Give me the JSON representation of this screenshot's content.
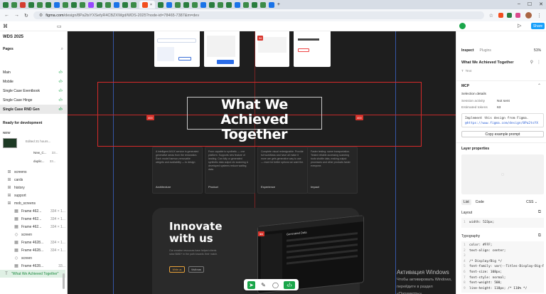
{
  "browser": {
    "url_host": "figma.com",
    "url_path": "/design/8Pa2tsYXSefyR4CBZXWgd/WDS-2025?node-id=78465-7387&m=dev",
    "tab_icon_colors": [
      "#2a7d3f",
      "#3c8b48",
      "#d43b2f",
      "#2a7d3f",
      "#3c8b48",
      "#2a7d3f",
      "#1a73e8",
      "#3c8b48",
      "#2a7d3f",
      "#3c8b48",
      "#9747ff",
      "#2a7d3f",
      "#3c8b48",
      "#1a73e8",
      "#2a7d3f",
      "#3c8b48",
      "#2a7d3f",
      "#1a73e8",
      "#3c8b48",
      "#2a7d3f",
      "#3c8b48",
      "#1a73e8",
      "#2a7d3f",
      "#3c8b48",
      "#2a7d3f",
      "#1a73e8",
      "#3c8b48",
      "#2a7d3f",
      "#3c8b48",
      "#1a73e8"
    ],
    "active_tab_close": "×",
    "new_tab": "+",
    "ext_colors": [
      "#f24e1e",
      "#2a7d3f",
      "#d94a8c"
    ]
  },
  "left": {
    "file_name": "WDS 2025",
    "pages_label": "Pages",
    "pages": [
      "Main",
      "Mobile",
      "Single Case Eventbook",
      "Single Case Hinge",
      "Single Case RND Gen"
    ],
    "ready_label": "Ready for development",
    "new_label": "NEW",
    "thumb_line1": "Edited 21 hours...",
    "thumb_line2": "New_C...",
    "thumb_line2_meta": "33...",
    "thumb_line3": "duplic...",
    "thumb_line3_meta": "33...",
    "layers": [
      {
        "icon": "⊞",
        "name": "screens"
      },
      {
        "icon": "⊞",
        "name": "cards"
      },
      {
        "icon": "⊞",
        "name": "history"
      },
      {
        "icon": "⊞",
        "name": "support"
      },
      {
        "icon": "⊞",
        "name": "mob_screens"
      },
      {
        "icon": "▦",
        "name": "Frame 462...",
        "meta": "334 × 1..."
      },
      {
        "icon": "▦",
        "name": "Frame 462...",
        "meta": "334 × 1..."
      },
      {
        "icon": "▦",
        "name": "Frame 462...",
        "meta": "334 × 1..."
      },
      {
        "icon": "◇",
        "name": "screen"
      },
      {
        "icon": "▦",
        "name": "Frame 4628...",
        "meta": "334 × 1..."
      },
      {
        "icon": "▦",
        "name": "Frame 4628...",
        "meta": "334 × 1..."
      },
      {
        "icon": "◇",
        "name": "screen"
      },
      {
        "icon": "▦",
        "name": "Frame 4628...",
        "meta": "33..."
      },
      {
        "icon": "T",
        "name": "\"What We Achieved Together\"",
        "selected": true
      }
    ]
  },
  "canvas": {
    "hero_title_line1": "What We Achieved",
    "hero_title_line2": "Together",
    "badge_left": "400",
    "badge_right": "400",
    "badge_top": "96",
    "cards": [
      {
        "text": "A intelligent AI/UX service in generated generative areas from the restoration. Each model harmon-removable widgets and availability — to design",
        "caption": "Architecture"
      },
      {
        "text": "From capable to synthetic — one platform. Supports new feature of landing. Can fully or generated synthetic data output ctx scanning & developed systems reduce waiting data.",
        "caption": "Product"
      },
      {
        "text": "Complete visual redesignable. Provide full workflows and have all make it more are gets generative way to use — more be better options we want the.",
        "caption": "Experience"
      },
      {
        "text": "Faster testing: same transportation. Tested reliable accessing scanning tools shuttle data, making output processes and other products faster everyone.",
        "caption": "Impact"
      }
    ],
    "innovate_title_line1": "Innovate",
    "innovate_title_line2": "with us",
    "innovate_text": "Our creative resources have helped clients raise $680+ in the path towards their match.",
    "btn_primary": "Write us",
    "btn_secondary": "Visit now",
    "laptop_label": "Generated Data",
    "activate_line1": "Активация Windows",
    "activate_line2": "Чтобы активировать Windows, перейдите в раздел «Параметры»."
  },
  "right": {
    "share_label": "Share",
    "tabs": [
      "Inspect",
      "Plugins"
    ],
    "zoom": "51%",
    "title": "What We Achieved Together",
    "type_label": "Text",
    "mcp_label": "MCP",
    "selection_label": "Selection details",
    "session_key": "Session activity",
    "session_val": "Not sent",
    "tokens_key": "Estimated tokens",
    "tokens_val": "63",
    "prompt_text_line1": "Implement this design from Figma.",
    "prompt_text_line2": "@https://www.figma.com/design/8Pa2tsYX",
    "copy_btn": "Copy example prompt",
    "layer_props": "Layer properties",
    "code_tabs": [
      "List",
      "Code"
    ],
    "code_lang": "CSS",
    "layout_label": "Layout",
    "layout_code_num": "1",
    "layout_code": "width: 523px;",
    "typography_label": "Typography",
    "typo_lines": [
      {
        "n": "1",
        "t": "color: #FFF;"
      },
      {
        "n": "2",
        "t": "text-align: center;"
      },
      {
        "n": "3",
        "t": ""
      },
      {
        "n": "4",
        "t": "/* Display/Big */"
      },
      {
        "n": "5",
        "t": "font-family: var(--Titles-Display-Big-F"
      },
      {
        "n": "6",
        "t": "font-size: 108px;"
      },
      {
        "n": "7",
        "t": "font-style: normal;"
      },
      {
        "n": "8",
        "t": "font-weight: 500;"
      },
      {
        "n": "9",
        "t": "line-height: 118px; /* 110% */"
      }
    ]
  }
}
